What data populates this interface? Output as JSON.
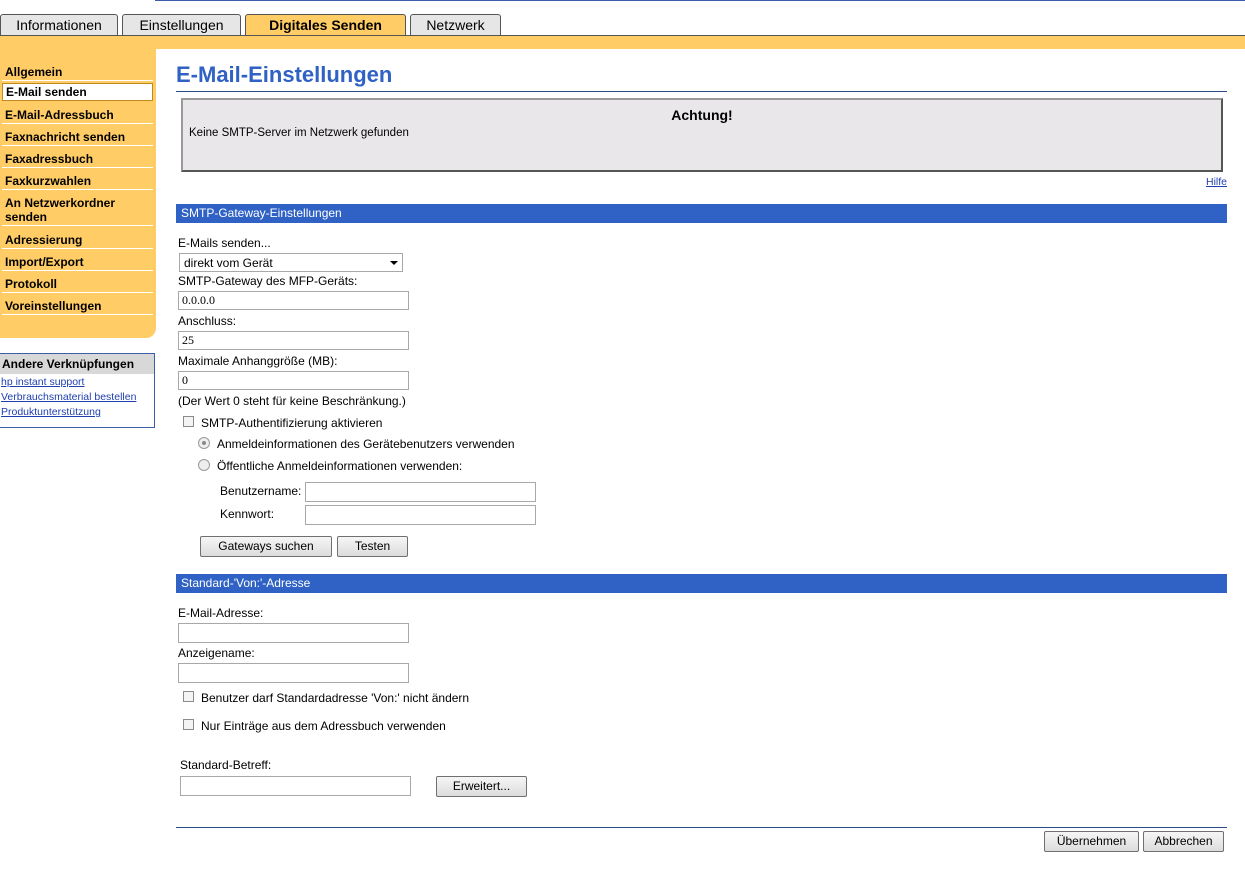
{
  "tabs": [
    {
      "label": "Informationen",
      "active": false
    },
    {
      "label": "Einstellungen",
      "active": false
    },
    {
      "label": "Digitales Senden",
      "active": true
    },
    {
      "label": "Netzwerk",
      "active": false
    }
  ],
  "nav": {
    "items": [
      {
        "label": "Allgemein"
      },
      {
        "label": "E-Mail senden",
        "selected": true
      },
      {
        "label": "E-Mail-Adressbuch"
      },
      {
        "label": "Faxnachricht senden"
      },
      {
        "label": "Faxadressbuch"
      },
      {
        "label": "Faxkurzwahlen"
      },
      {
        "label": "An Netzwerkordner senden"
      },
      {
        "label": "Adressierung"
      },
      {
        "label": "Import/Export"
      },
      {
        "label": "Protokoll"
      },
      {
        "label": "Voreinstellungen"
      }
    ]
  },
  "links": {
    "title": "Andere Verknüpfungen",
    "items": [
      "hp instant support",
      "Verbrauchsmaterial bestellen",
      "Produktunterstützung"
    ]
  },
  "page": {
    "title": "E-Mail-Einstellungen",
    "help": "Hilfe"
  },
  "alert": {
    "title": "Achtung!",
    "text": "Keine SMTP-Server im Netzwerk gefunden"
  },
  "smtp": {
    "section_title": "SMTP-Gateway-Einstellungen",
    "send_label": "E-Mails senden...",
    "send_value": "direkt vom Gerät",
    "gateway_label": "SMTP-Gateway des MFP-Geräts:",
    "gateway_value": "0.0.0.0",
    "port_label": "Anschluss:",
    "port_value": "25",
    "max_label": "Maximale Anhanggröße (MB):",
    "max_value": "0",
    "max_note": "(Der Wert 0 steht für keine Beschränkung.)",
    "auth_label": "SMTP-Authentifizierung aktivieren",
    "auth_checked": false,
    "radio_device": "Anmeldeinformationen des Gerätebenutzers verwenden",
    "radio_public": "Öffentliche Anmeldeinformationen verwenden:",
    "username_label": "Benutzername:",
    "username_value": "",
    "password_label": "Kennwort:",
    "password_value": "",
    "find_button": "Gateways suchen",
    "test_button": "Testen"
  },
  "from": {
    "section_title": "Standard-'Von:'-Adresse",
    "email_label": "E-Mail-Adresse:",
    "email_value": "",
    "display_label": "Anzeigename:",
    "display_value": "",
    "lock_label": "Benutzer darf Standardadresse 'Von:' nicht ändern",
    "lock_checked": false,
    "addressbook_label": "Nur Einträge aus dem Adressbuch verwenden",
    "addressbook_checked": false,
    "subject_label": "Standard-Betreff:",
    "subject_value": "",
    "advanced_button": "Erweitert..."
  },
  "footer": {
    "apply_button": "Übernehmen",
    "cancel_button": "Abbrechen"
  }
}
